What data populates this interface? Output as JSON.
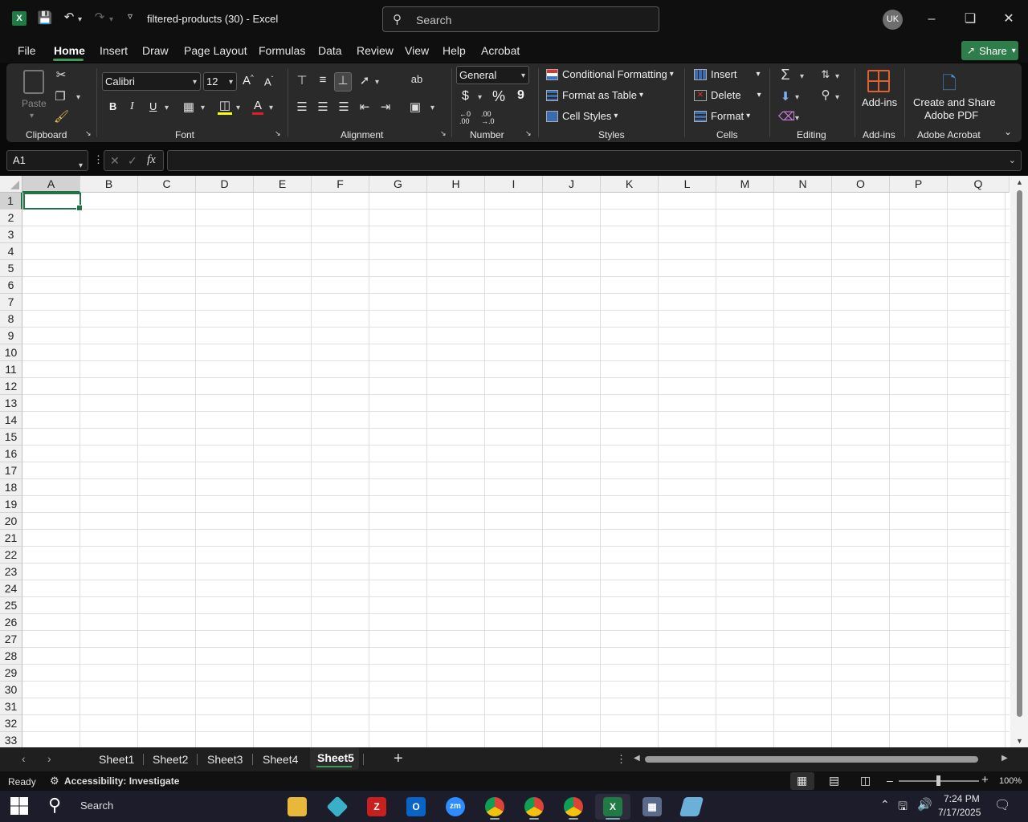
{
  "app": {
    "title": "filtered-products (30)  -  Excel",
    "search_placeholder": "Search",
    "user_initials": "UK"
  },
  "menu": {
    "tabs": [
      "File",
      "Home",
      "Insert",
      "Draw",
      "Page Layout",
      "Formulas",
      "Data",
      "Review",
      "View",
      "Help",
      "Acrobat"
    ],
    "active": "Home",
    "share_label": "Share"
  },
  "ribbon": {
    "clipboard": {
      "paste_label": "Paste",
      "group_label": "Clipboard"
    },
    "font": {
      "font_name": "Calibri",
      "font_size": "12",
      "group_label": "Font"
    },
    "alignment": {
      "group_label": "Alignment"
    },
    "number": {
      "format": "General",
      "currency": "$",
      "percent": "%",
      "comma": "9",
      "group_label": "Number"
    },
    "styles": {
      "conditional": "Conditional Formatting",
      "format_table": "Format as Table",
      "cell_styles": "Cell Styles",
      "group_label": "Styles"
    },
    "cells": {
      "insert": "Insert",
      "delete": "Delete",
      "format": "Format",
      "group_label": "Cells"
    },
    "editing": {
      "group_label": "Editing"
    },
    "addins": {
      "label": "Add-ins",
      "group_label": "Add-ins"
    },
    "acrobat": {
      "label_line1": "Create and Share",
      "label_line2": "Adobe PDF",
      "group_label": "Adobe Acrobat"
    }
  },
  "formula_bar": {
    "name_box": "A1",
    "fx": "fx",
    "formula": ""
  },
  "grid": {
    "columns": [
      "A",
      "B",
      "C",
      "D",
      "E",
      "F",
      "G",
      "H",
      "I",
      "J",
      "K",
      "L",
      "M",
      "N",
      "O",
      "P",
      "Q"
    ],
    "rows": [
      "1",
      "2",
      "3",
      "4",
      "5",
      "6",
      "7",
      "8",
      "9",
      "10",
      "11",
      "12",
      "13",
      "14",
      "15",
      "16",
      "17",
      "18",
      "19",
      "20",
      "21",
      "22",
      "23",
      "24",
      "25",
      "26",
      "27",
      "28",
      "29",
      "30",
      "31",
      "32",
      "33"
    ],
    "selected_cell": "A1"
  },
  "sheets": {
    "tabs": [
      "Sheet1",
      "Sheet2",
      "Sheet3",
      "Sheet4",
      "Sheet5"
    ],
    "active": "Sheet5"
  },
  "status": {
    "ready": "Ready",
    "accessibility": "Accessibility: Investigate",
    "zoom": "100%"
  },
  "taskbar": {
    "search": "Search",
    "time": "7:24 PM",
    "date": "7/17/2025"
  },
  "colors": {
    "accent": "#217346",
    "share": "#2f7d4a",
    "ribbon_bg": "#2a2a2a"
  }
}
